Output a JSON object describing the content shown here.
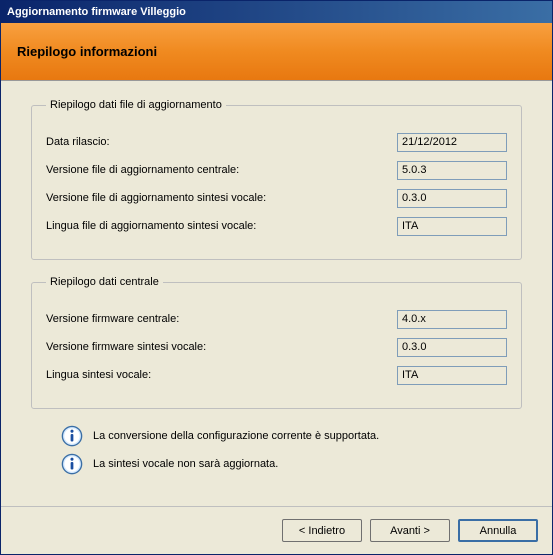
{
  "window": {
    "title": "Aggiornamento firmware Villeggio"
  },
  "header": {
    "title": "Riepilogo informazioni"
  },
  "group_update": {
    "legend": "Riepilogo dati file di aggiornamento",
    "rows": [
      {
        "label": "Data rilascio:",
        "value": "21/12/2012"
      },
      {
        "label": "Versione file di aggiornamento centrale:",
        "value": "5.0.3"
      },
      {
        "label": "Versione file di aggiornamento sintesi vocale:",
        "value": "0.3.0"
      },
      {
        "label": "Lingua file di aggiornamento sintesi vocale:",
        "value": "ITA"
      }
    ]
  },
  "group_central": {
    "legend": "Riepilogo dati centrale",
    "rows": [
      {
        "label": "Versione firmware centrale:",
        "value": "4.0.x"
      },
      {
        "label": "Versione firmware sintesi vocale:",
        "value": "0.3.0"
      },
      {
        "label": "Lingua sintesi vocale:",
        "value": "ITA"
      }
    ]
  },
  "info_messages": [
    "La conversione della configurazione corrente è supportata.",
    "La sintesi vocale non sarà aggiornata."
  ],
  "buttons": {
    "back": "< Indietro",
    "next": "Avanti >",
    "cancel": "Annulla"
  }
}
